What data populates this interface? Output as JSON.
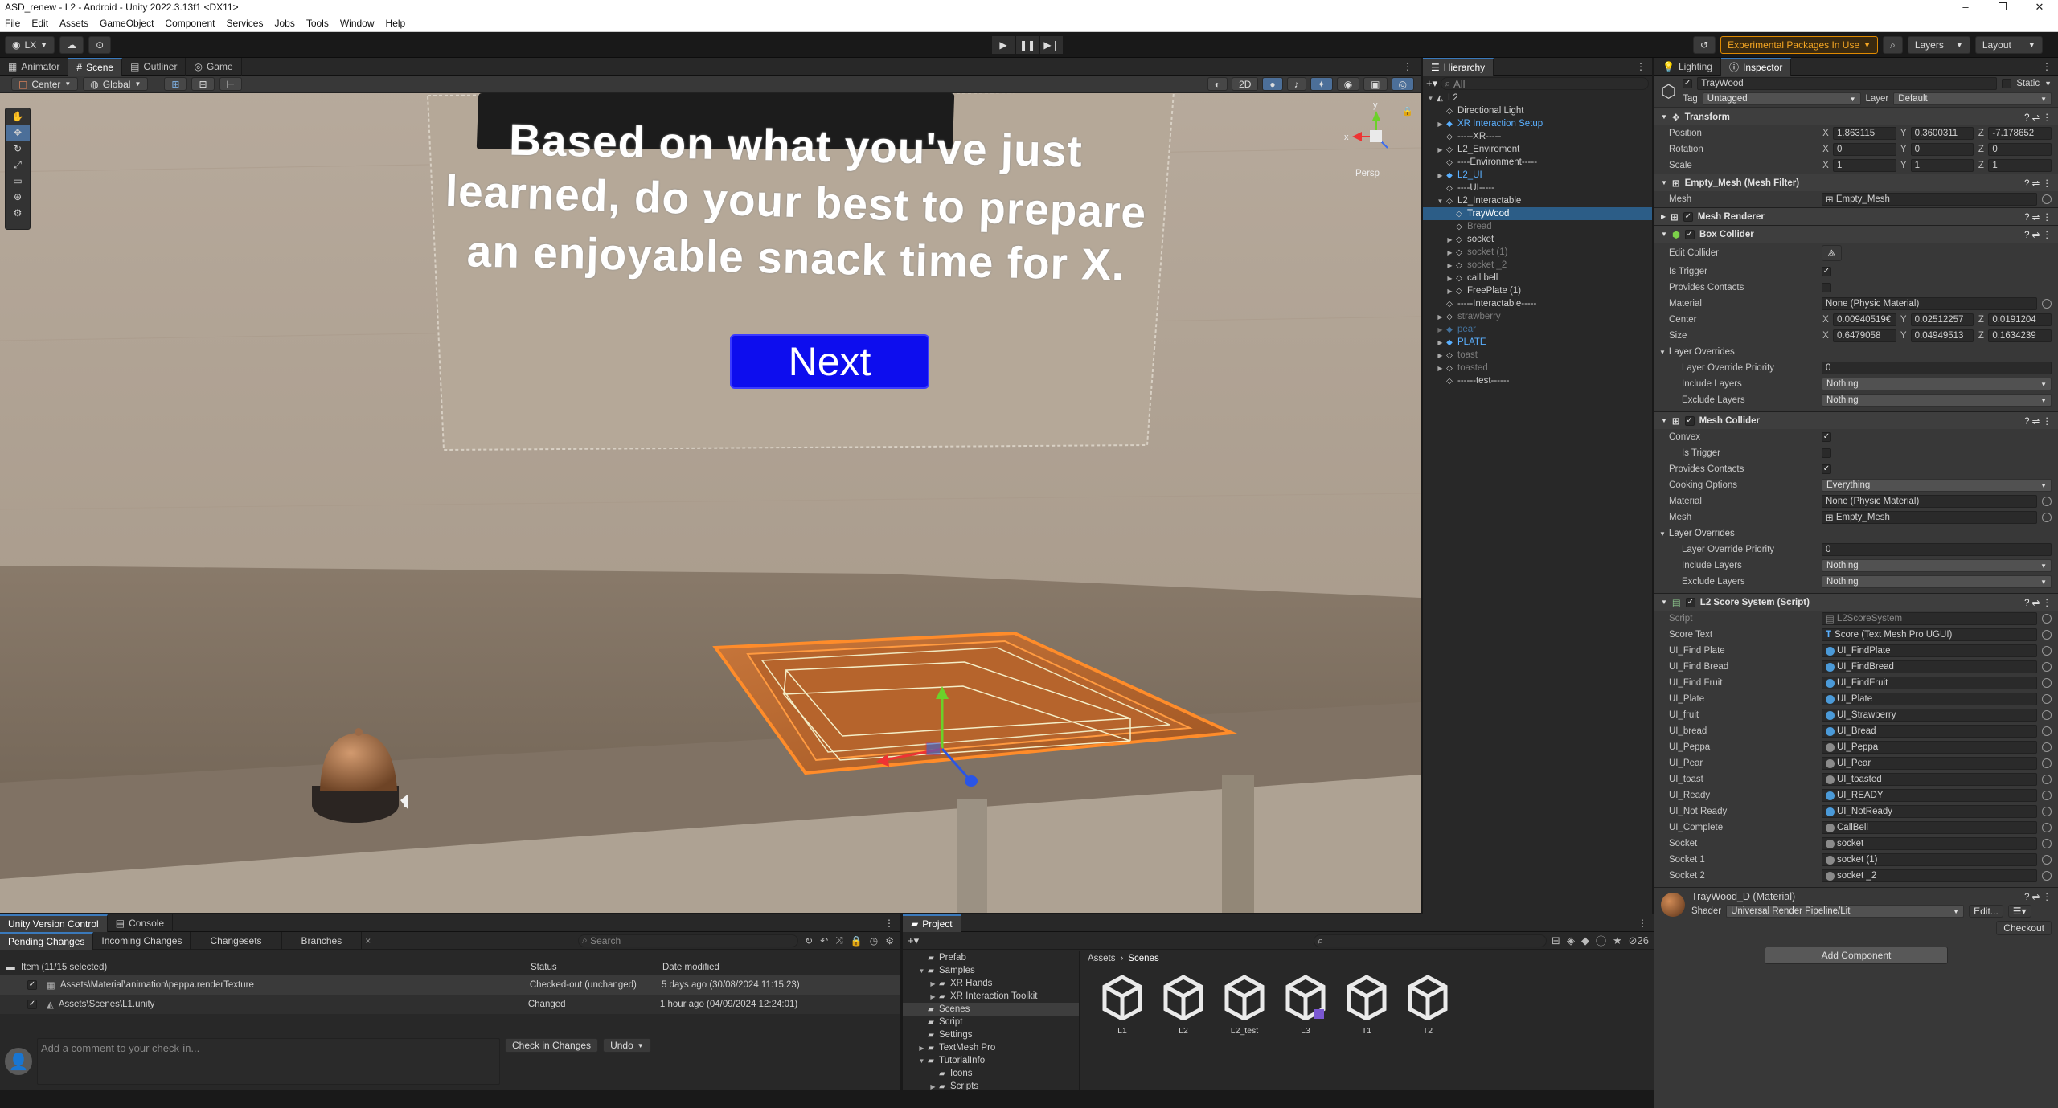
{
  "window": {
    "title": "ASD_renew - L2 - Android - Unity 2022.3.13f1 <DX11>",
    "minimize": "–",
    "maximize": "❐",
    "close": "✕"
  },
  "menu": [
    "File",
    "Edit",
    "Assets",
    "GameObject",
    "Component",
    "Services",
    "Jobs",
    "Tools",
    "Window",
    "Help"
  ],
  "toolbar": {
    "account": "LX",
    "experimental": "Experimental Packages In Use",
    "layers": "Layers",
    "layout": "Layout"
  },
  "left_tabs": [
    "Animator",
    "Scene",
    "Outliner",
    "Game"
  ],
  "scene_toolbar": {
    "pivot": "Center",
    "space": "Global",
    "mode2d": "2D",
    "persp": "Persp"
  },
  "scene": {
    "ui_text": "Based on what you've just learned, do your best to prepare an enjoyable snack time for X.",
    "ui_text_line1": "Based on what you've just",
    "ui_text_line2": "learned, do your best to prepare",
    "ui_text_line3": "an enjoyable snack time for X.",
    "next_button": "Next"
  },
  "hierarchy": {
    "tab": "Hierarchy",
    "search_placeholder": "All",
    "items": [
      {
        "label": "L2",
        "indent": 0,
        "arrow": "▼",
        "style": "",
        "icon": "unity"
      },
      {
        "label": "Directional Light",
        "indent": 1,
        "arrow": "",
        "style": "",
        "icon": "cube"
      },
      {
        "label": "XR Interaction Setup",
        "indent": 1,
        "arrow": "▶",
        "style": "blue",
        "icon": "prefab"
      },
      {
        "label": "-----XR-----",
        "indent": 1,
        "arrow": "",
        "style": "",
        "icon": "cube"
      },
      {
        "label": "L2_Enviroment",
        "indent": 1,
        "arrow": "▶",
        "style": "",
        "icon": "cube"
      },
      {
        "label": "----Environment-----",
        "indent": 1,
        "arrow": "",
        "style": "",
        "icon": "cube"
      },
      {
        "label": "L2_UI",
        "indent": 1,
        "arrow": "▶",
        "style": "blue",
        "icon": "prefab"
      },
      {
        "label": "----UI-----",
        "indent": 1,
        "arrow": "",
        "style": "",
        "icon": "cube"
      },
      {
        "label": "L2_Interactable",
        "indent": 1,
        "arrow": "▼",
        "style": "",
        "icon": "cube"
      },
      {
        "label": "TrayWood",
        "indent": 2,
        "arrow": "",
        "style": "sel",
        "icon": "cube"
      },
      {
        "label": "Bread",
        "indent": 2,
        "arrow": "",
        "style": "dim",
        "icon": "cube"
      },
      {
        "label": "socket",
        "indent": 2,
        "arrow": "▶",
        "style": "",
        "icon": "cube"
      },
      {
        "label": "socket (1)",
        "indent": 2,
        "arrow": "▶",
        "style": "dim",
        "icon": "cube"
      },
      {
        "label": "socket _2",
        "indent": 2,
        "arrow": "▶",
        "style": "dim",
        "icon": "cube"
      },
      {
        "label": "call bell",
        "indent": 2,
        "arrow": "▶",
        "style": "",
        "icon": "cube"
      },
      {
        "label": "FreePlate (1)",
        "indent": 2,
        "arrow": "▶",
        "style": "",
        "icon": "cube"
      },
      {
        "label": "-----Interactable-----",
        "indent": 1,
        "arrow": "",
        "style": "",
        "icon": "cube"
      },
      {
        "label": "strawberry",
        "indent": 1,
        "arrow": "▶",
        "style": "dim",
        "icon": "cube"
      },
      {
        "label": "pear",
        "indent": 1,
        "arrow": "▶",
        "style": "dimblue",
        "icon": "prefab"
      },
      {
        "label": "PLATE",
        "indent": 1,
        "arrow": "▶",
        "style": "blue",
        "icon": "prefab"
      },
      {
        "label": "toast",
        "indent": 1,
        "arrow": "▶",
        "style": "dim",
        "icon": "cube"
      },
      {
        "label": "toasted",
        "indent": 1,
        "arrow": "▶",
        "style": "dim",
        "icon": "cube"
      },
      {
        "label": "------test------",
        "indent": 1,
        "arrow": "",
        "style": "",
        "icon": "cube"
      }
    ]
  },
  "inspector": {
    "tabs": [
      "Lighting",
      "Inspector"
    ],
    "object_name": "TrayWood",
    "static_label": "Static",
    "tag_label": "Tag",
    "tag_value": "Untagged",
    "layer_label": "Layer",
    "layer_value": "Default",
    "transform": {
      "title": "Transform",
      "position": {
        "label": "Position",
        "x": "1.863115",
        "y": "0.3600311",
        "z": "-7.178652"
      },
      "rotation": {
        "label": "Rotation",
        "x": "0",
        "y": "0",
        "z": "0"
      },
      "scale": {
        "label": "Scale",
        "x": "1",
        "y": "1",
        "z": "1"
      }
    },
    "mesh_filter": {
      "title": "Empty_Mesh (Mesh Filter)",
      "mesh_label": "Mesh",
      "mesh_value": "Empty_Mesh"
    },
    "mesh_renderer": {
      "title": "Mesh Renderer"
    },
    "box_collider": {
      "title": "Box Collider",
      "edit_collider": "Edit Collider",
      "is_trigger": "Is Trigger",
      "provides_contacts": "Provides Contacts",
      "material_label": "Material",
      "material_value": "None (Physic Material)",
      "center": {
        "label": "Center",
        "x": "0.00940519€",
        "y": "0.02512257",
        "z": "0.0191204"
      },
      "size": {
        "label": "Size",
        "x": "0.6479058",
        "y": "0.04949513",
        "z": "0.1634239"
      },
      "layer_overrides": "Layer Overrides",
      "priority_label": "Layer Override Priority",
      "priority_value": "0",
      "include_label": "Include Layers",
      "include_value": "Nothing",
      "exclude_label": "Exclude Layers",
      "exclude_value": "Nothing"
    },
    "mesh_collider": {
      "title": "Mesh Collider",
      "convex": "Convex",
      "is_trigger": "Is Trigger",
      "provides_contacts": "Provides Contacts",
      "cooking_label": "Cooking Options",
      "cooking_value": "Everything",
      "material_label": "Material",
      "material_value": "None (Physic Material)",
      "mesh_label": "Mesh",
      "mesh_value": "Empty_Mesh",
      "layer_overrides": "Layer Overrides",
      "priority_label": "Layer Override Priority",
      "priority_value": "0",
      "include_label": "Include Layers",
      "include_value": "Nothing",
      "exclude_label": "Exclude Layers",
      "exclude_value": "Nothing"
    },
    "score_system": {
      "title": "L2 Score System (Script)",
      "fields": [
        {
          "label": "Script",
          "value": "L2ScoreSystem",
          "icon": "script",
          "dim": true
        },
        {
          "label": "Score Text",
          "value": "Score (Text Mesh Pro UGUI)",
          "icon": "text"
        },
        {
          "label": "UI_Find Plate",
          "value": "UI_FindPlate",
          "icon": "obj"
        },
        {
          "label": "UI_Find Bread",
          "value": "UI_FindBread",
          "icon": "obj"
        },
        {
          "label": "UI_Find Fruit",
          "value": "UI_FindFruit",
          "icon": "obj"
        },
        {
          "label": "UI_Plate",
          "value": "UI_Plate",
          "icon": "obj"
        },
        {
          "label": "UI_fruit",
          "value": "UI_Strawberry",
          "icon": "obj"
        },
        {
          "label": "UI_bread",
          "value": "UI_Bread",
          "icon": "obj"
        },
        {
          "label": "UI_Peppa",
          "value": "UI_Peppa",
          "icon": "grey"
        },
        {
          "label": "UI_Pear",
          "value": "UI_Pear",
          "icon": "grey"
        },
        {
          "label": "UI_toast",
          "value": "UI_toasted",
          "icon": "grey"
        },
        {
          "label": "UI_Ready",
          "value": "UI_READY",
          "icon": "obj"
        },
        {
          "label": "UI_Not Ready",
          "value": "UI_NotReady",
          "icon": "obj"
        },
        {
          "label": "UI_Complete",
          "value": "CallBell",
          "icon": "grey"
        },
        {
          "label": "Socket",
          "value": "socket",
          "icon": "grey"
        },
        {
          "label": "Socket 1",
          "value": "socket (1)",
          "icon": "grey"
        },
        {
          "label": "Socket 2",
          "value": "socket _2",
          "icon": "grey"
        }
      ]
    },
    "material": {
      "title": "TrayWood_D (Material)",
      "shader_label": "Shader",
      "shader_value": "Universal Render Pipeline/Lit",
      "edit": "Edit...",
      "checkout": "Checkout"
    },
    "add_component": "Add Component"
  },
  "vc": {
    "tabs": [
      "Unity Version Control",
      "Console"
    ],
    "subtabs": [
      "Pending Changes",
      "Incoming Changes",
      "Changesets",
      "Branches"
    ],
    "search_placeholder": "Search",
    "col_item": "Item (11/15 selected)",
    "col_status": "Status",
    "col_date": "Date modified",
    "rows": [
      {
        "path": "Assets\\Material\\animation\\peppa.renderTexture",
        "status": "Checked-out (unchanged)",
        "date": "5 days ago (30/08/2024 11:15:23)"
      },
      {
        "path": "Assets\\Scenes\\L1.unity",
        "status": "Changed",
        "date": "1 hour ago (04/09/2024 12:24:01)"
      }
    ],
    "comment_placeholder": "Add a comment to your check-in...",
    "checkin": "Check in Changes",
    "undo": "Undo"
  },
  "project": {
    "tab": "Project",
    "count": "26",
    "tree": [
      {
        "label": "Prefab",
        "indent": 1,
        "arrow": ""
      },
      {
        "label": "Samples",
        "indent": 1,
        "arrow": "▼"
      },
      {
        "label": "XR Hands",
        "indent": 2,
        "arrow": "▶"
      },
      {
        "label": "XR Interaction Toolkit",
        "indent": 2,
        "arrow": "▶"
      },
      {
        "label": "Scenes",
        "indent": 1,
        "arrow": "",
        "sel": true
      },
      {
        "label": "Script",
        "indent": 1,
        "arrow": ""
      },
      {
        "label": "Settings",
        "indent": 1,
        "arrow": ""
      },
      {
        "label": "TextMesh Pro",
        "indent": 1,
        "arrow": "▶"
      },
      {
        "label": "TutorialInfo",
        "indent": 1,
        "arrow": "▼"
      },
      {
        "label": "Icons",
        "indent": 2,
        "arrow": ""
      },
      {
        "label": "Scripts",
        "indent": 2,
        "arrow": "▶"
      }
    ],
    "breadcrumb_root": "Assets",
    "breadcrumb_leaf": "Scenes",
    "scenes": [
      "L1",
      "L2",
      "L2_test",
      "L3",
      "T1",
      "T2"
    ]
  }
}
